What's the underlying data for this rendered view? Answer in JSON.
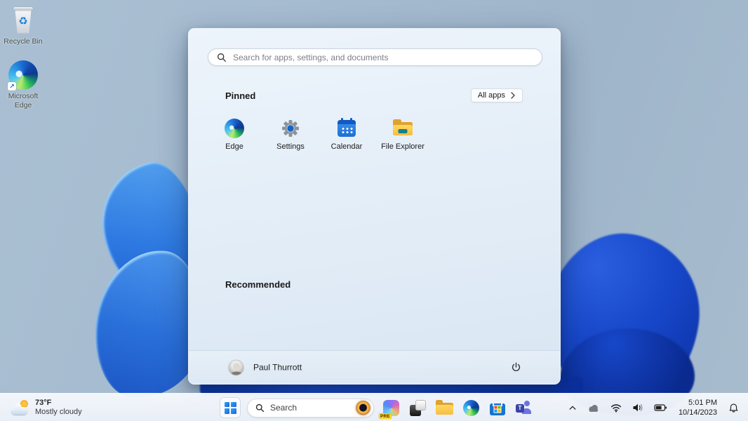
{
  "desktop": {
    "icons": [
      {
        "label": "Recycle Bin"
      },
      {
        "label": "Microsoft Edge"
      }
    ]
  },
  "start_menu": {
    "search": {
      "placeholder": "Search for apps, settings, and documents"
    },
    "pinned_title": "Pinned",
    "all_apps_label": "All apps",
    "pinned_apps": [
      {
        "label": "Edge"
      },
      {
        "label": "Settings"
      },
      {
        "label": "Calendar"
      },
      {
        "label": "File Explorer"
      }
    ],
    "recommended_title": "Recommended",
    "user": {
      "name": "Paul Thurrott"
    }
  },
  "taskbar": {
    "weather": {
      "temperature": "73°F",
      "condition": "Mostly cloudy"
    },
    "search_label": "Search",
    "copilot_badge": "PRE",
    "tray": {
      "time": "5:01 PM",
      "date": "10/14/2023"
    }
  },
  "icons": {
    "search": "magnifier",
    "power": "power-circle",
    "chevron_up": "caret-up",
    "onedrive": "cloud",
    "network": "wifi-arcs",
    "volume": "speaker",
    "battery": "battery",
    "notifications": "bell",
    "start": "windows-grid",
    "bing": "eclipse-ball",
    "weather": "sun-behind-cloud"
  },
  "colors": {
    "accent": "#1565d8",
    "bloom_dark": "#1747c9",
    "bloom_light": "#3f8ce9",
    "menu_bg": "#e4eef8",
    "taskbar_bg": "#f0f4fa",
    "folder_yellow": "#f6bd42"
  }
}
